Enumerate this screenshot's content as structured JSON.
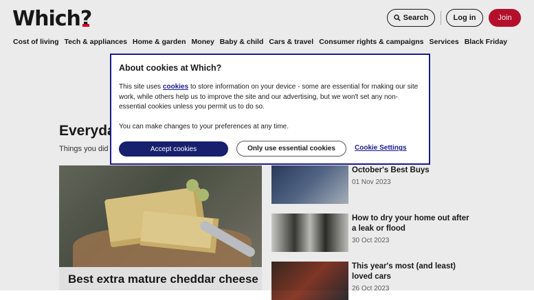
{
  "header": {
    "logo_text": "Which",
    "logo_mark": "?",
    "search_label": "Search",
    "login_label": "Log in",
    "join_label": "Join"
  },
  "nav": {
    "items": [
      {
        "label": "Cost of living"
      },
      {
        "label": "Tech & appliances"
      },
      {
        "label": "Home & garden"
      },
      {
        "label": "Money"
      },
      {
        "label": "Baby & child"
      },
      {
        "label": "Cars & travel"
      },
      {
        "label": "Consumer rights & campaigns"
      },
      {
        "label": "Services"
      },
      {
        "label": "Black Friday"
      }
    ]
  },
  "main": {
    "section_title": "Everyda",
    "section_subtitle": "Things you did",
    "hero_title": "Best extra mature cheddar cheese",
    "articles": [
      {
        "title": "October's Best Buys",
        "date": "01 Nov 2023"
      },
      {
        "title": "How to dry your home out after a leak or flood",
        "date": "30 Oct 2023"
      },
      {
        "title": "This year's most (and least) loved cars",
        "date": "26 Oct 2023"
      }
    ]
  },
  "cookie_modal": {
    "title": "About cookies at Which?",
    "text_before_link": "This site uses ",
    "link_text": "cookies",
    "text_after_link": " to store information on your device - some are essential for making our site work, while others help us to improve the site and our advertising, but we won't set any non-essential cookies unless you permit us to do so.",
    "preferences_text": "You can make changes to your preferences at any time.",
    "accept_label": "Accept cookies",
    "essential_label": "Only use essential cookies",
    "settings_label": "Cookie Settings"
  },
  "colors": {
    "brand_red": "#c4122f",
    "accept_navy": "#16206e",
    "link_blue": "#1a1a8c"
  }
}
